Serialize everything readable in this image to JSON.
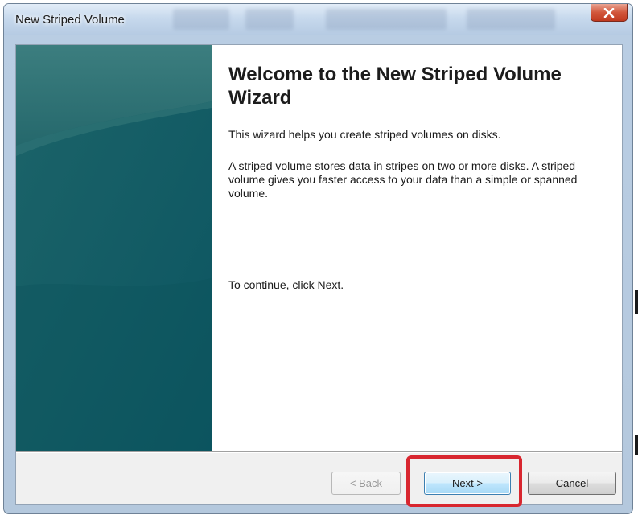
{
  "window": {
    "title": "New Striped Volume"
  },
  "wizard": {
    "heading": "Welcome to the New Striped Volume Wizard",
    "paragraphs": [
      "This wizard helps you create striped volumes on disks.",
      "A striped volume stores data in stripes on two or more disks. A striped volume gives you faster access to your data than a simple or spanned volume.",
      "To continue, click Next."
    ]
  },
  "buttons": {
    "back": "< Back",
    "next": "Next >",
    "cancel": "Cancel"
  },
  "colors": {
    "banner": "#1d6167",
    "highlight": "#d8262f",
    "close_button": "#c0391f"
  },
  "icons": {
    "close": "close-icon"
  }
}
